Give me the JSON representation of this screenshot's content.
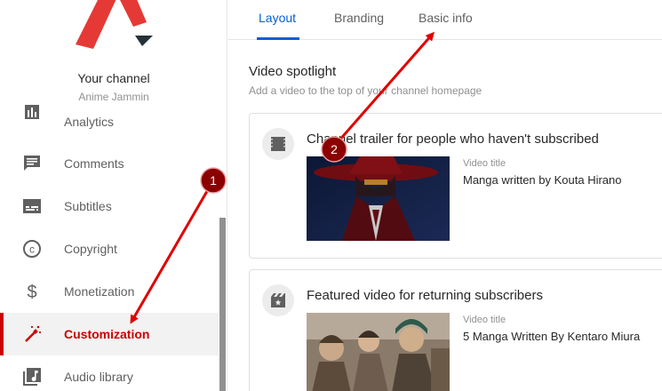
{
  "sidebar": {
    "channel_label": "Your channel",
    "channel_name": "Anime Jammin",
    "items": [
      {
        "label": "Analytics",
        "icon": "analytics-icon"
      },
      {
        "label": "Comments",
        "icon": "comments-icon"
      },
      {
        "label": "Subtitles",
        "icon": "subtitles-icon"
      },
      {
        "label": "Copyright",
        "icon": "copyright-icon"
      },
      {
        "label": "Monetization",
        "icon": "dollar-icon"
      },
      {
        "label": "Customization",
        "icon": "magic-wand-icon",
        "active": true
      },
      {
        "label": "Audio library",
        "icon": "audio-library-icon"
      }
    ]
  },
  "tabs": [
    {
      "label": "Layout",
      "active": true
    },
    {
      "label": "Branding"
    },
    {
      "label": "Basic info"
    }
  ],
  "video_spotlight": {
    "title": "Video spotlight",
    "subtitle": "Add a video to the top of your channel homepage"
  },
  "cards": [
    {
      "title": "Channel trailer for people who haven't subscribed",
      "icon": "film-icon",
      "video_title_label": "Video title",
      "video_title": "Manga written by Kouta Hirano"
    },
    {
      "title": "Featured video for returning subscribers",
      "icon": "featured-video-icon",
      "video_title_label": "Video title",
      "video_title": "5 Manga Written By Kentaro Miura"
    }
  ],
  "annotations": [
    {
      "number": "1"
    },
    {
      "number": "2"
    }
  ],
  "colors": {
    "accent_red": "#cc0000",
    "tab_blue": "#065fd4",
    "annotation_red": "#e00000"
  }
}
